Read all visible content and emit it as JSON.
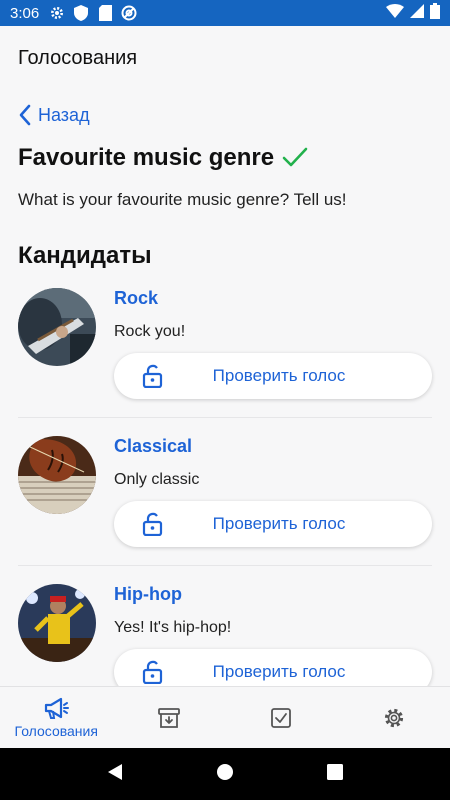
{
  "status_bar": {
    "time": "3:06"
  },
  "app_bar": {
    "title": "Голосования"
  },
  "back": {
    "label": "Назад"
  },
  "poll": {
    "title": "Favourite music genre",
    "description": "What is your favourite music genre? Tell us!"
  },
  "candidates_heading": "Кандидаты",
  "candidates": [
    {
      "name": "Rock",
      "description": "Rock you!",
      "verify_label": "Проверить голос"
    },
    {
      "name": "Classical",
      "description": "Only classic",
      "verify_label": "Проверить голос"
    },
    {
      "name": "Hip-hop",
      "description": "Yes! It's hip-hop!",
      "verify_label": "Проверить голос"
    }
  ],
  "bottom_nav": {
    "items": [
      {
        "label": "Голосования",
        "icon": "megaphone-icon",
        "active": true
      },
      {
        "label": "",
        "icon": "archive-icon",
        "active": false
      },
      {
        "label": "",
        "icon": "checkbox-icon",
        "active": false
      },
      {
        "label": "",
        "icon": "gear-icon",
        "active": false
      }
    ]
  },
  "colors": {
    "accent": "#1e63d6",
    "status_bar": "#1565c0",
    "check": "#22b14c"
  }
}
